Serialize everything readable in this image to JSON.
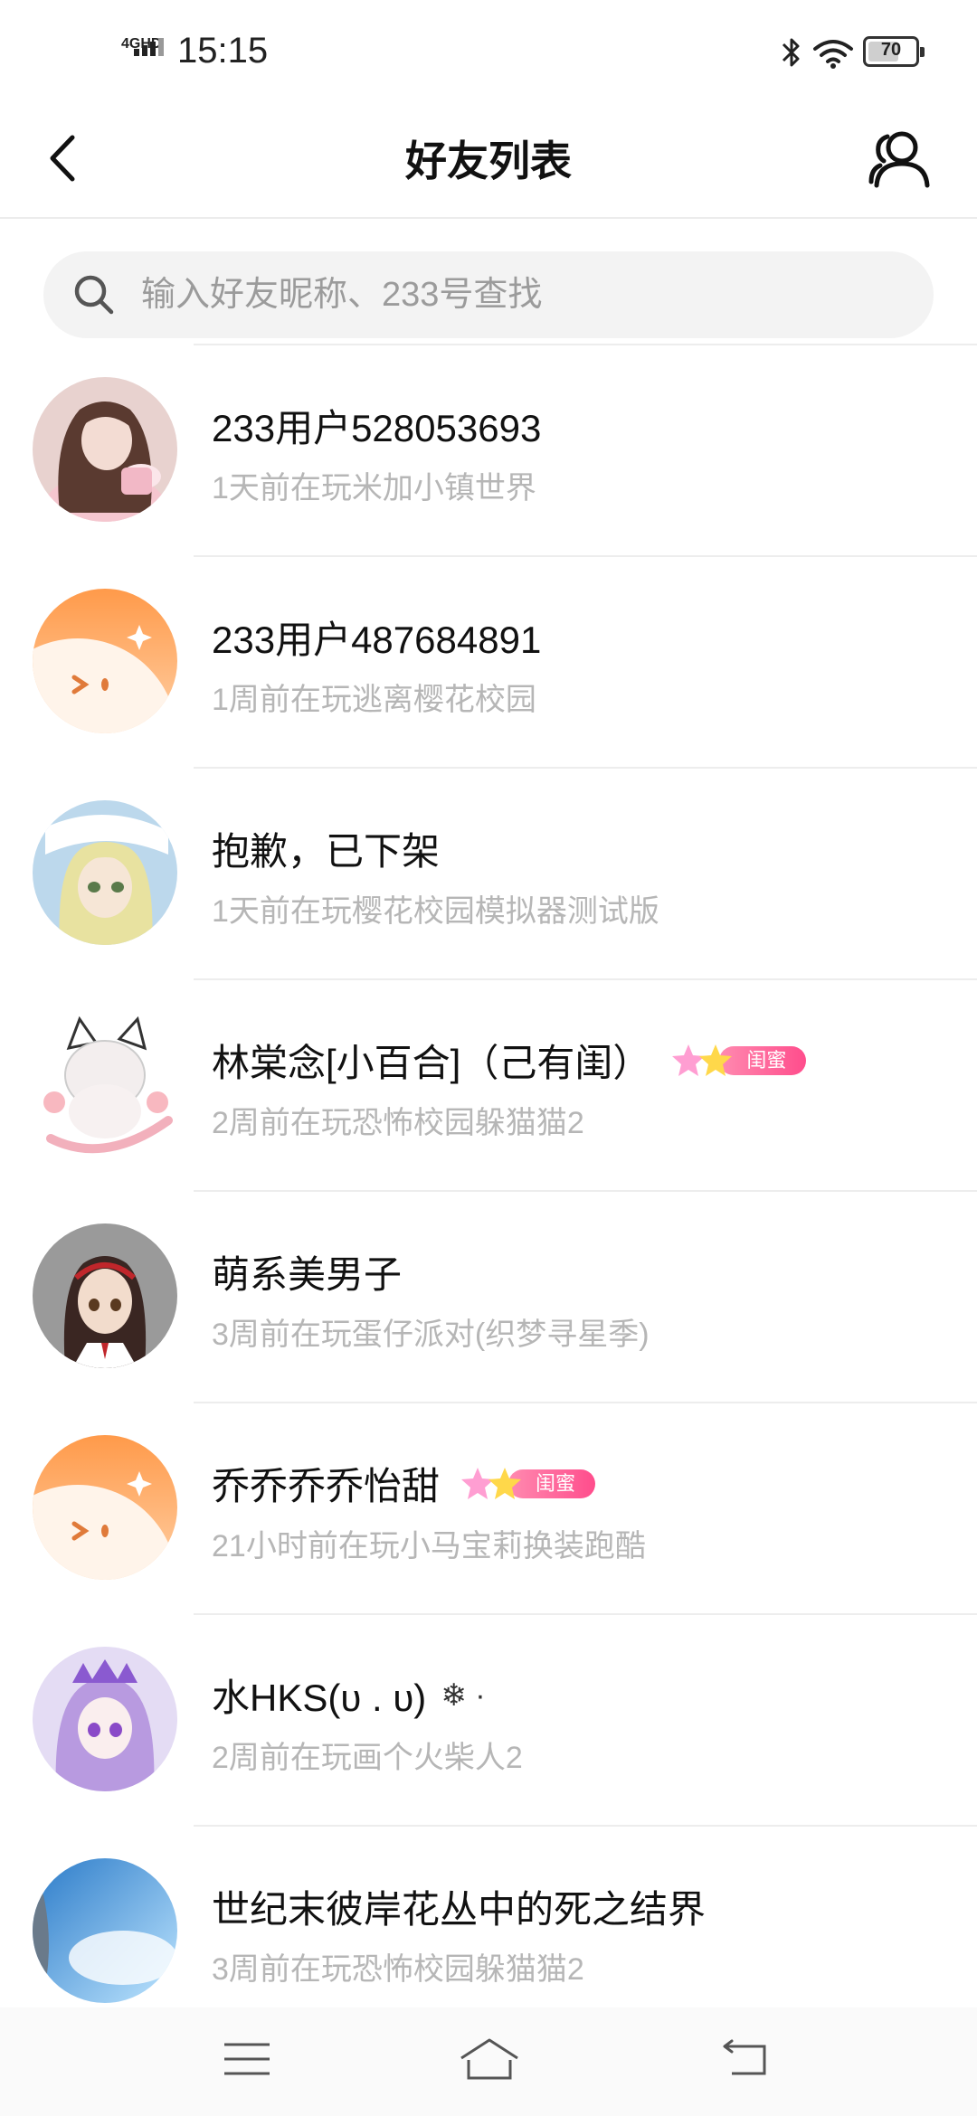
{
  "status_bar": {
    "network": "4GHD",
    "time": "15:15",
    "battery": "70",
    "battery_level": 0.7
  },
  "header": {
    "title": "好友列表",
    "back_icon": "back-arrow-icon",
    "right_icon": "contacts-icon"
  },
  "search": {
    "placeholder": "输入好友昵称、233号查找",
    "value": ""
  },
  "friends": [
    {
      "name": "233用户528053693",
      "status": "1天前在玩米加小镇世界",
      "avatar": "photo-girl"
    },
    {
      "name": "233用户487684891",
      "status": "1周前在玩逃离樱花校园",
      "avatar": "default-orange"
    },
    {
      "name": "抱歉，已下架",
      "status": "1天前在玩樱花校园模拟器测试版",
      "avatar": "anime-blonde"
    },
    {
      "name": "林棠念[小百合]（己有闺）",
      "status": "2周前在玩恐怖校园躲猫猫2",
      "avatar": "anime-cat",
      "badge": "闺蜜"
    },
    {
      "name": "萌系美男子",
      "status": "3周前在玩蛋仔派对(织梦寻星季)",
      "avatar": "3d-girl"
    },
    {
      "name": "乔乔乔乔怡甜",
      "status": "21小时前在玩小马宝莉换装跑酷",
      "avatar": "default-orange",
      "badge": "闺蜜"
    },
    {
      "name": "水HKS(ᴜ . ᴜ)",
      "status": "2周前在玩画个火柴人2",
      "avatar": "anime-purple",
      "suffix": "❄ ·"
    },
    {
      "name": "世纪末彼岸花丛中的死之结界",
      "status": "3周前在玩恐怖校园躲猫猫2",
      "avatar": "sky-blue"
    }
  ],
  "nav": {
    "menu_icon": "menu-icon",
    "home_icon": "home-icon",
    "back_icon": "back-icon"
  },
  "colors": {
    "badge_pink": "#ff4d8c",
    "default_avatar_orange": "#ff9a4d",
    "status_text": "#b6b6b6"
  }
}
